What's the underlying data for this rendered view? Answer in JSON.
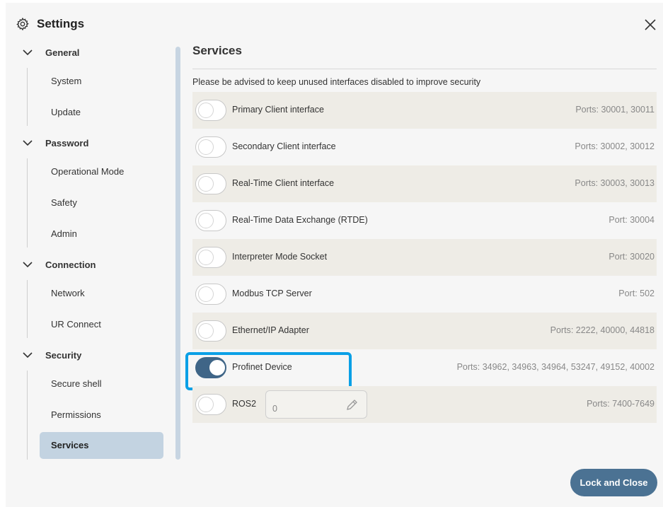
{
  "dialog": {
    "title": "Settings",
    "icon": "gear-icon",
    "close_icon": "close-icon"
  },
  "sidebar": {
    "sections": [
      {
        "label": "General",
        "items": [
          {
            "label": "System"
          },
          {
            "label": "Update"
          }
        ]
      },
      {
        "label": "Password",
        "items": [
          {
            "label": "Operational Mode"
          },
          {
            "label": "Safety"
          },
          {
            "label": "Admin"
          }
        ]
      },
      {
        "label": "Connection",
        "items": [
          {
            "label": "Network"
          },
          {
            "label": "UR Connect"
          }
        ]
      },
      {
        "label": "Security",
        "items": [
          {
            "label": "Secure shell"
          },
          {
            "label": "Permissions"
          },
          {
            "label": "Services",
            "active": true
          }
        ]
      }
    ]
  },
  "main": {
    "title": "Services",
    "advice": "Please be advised to keep unused interfaces disabled to improve security",
    "services": [
      {
        "name": "Primary Client interface",
        "ports": "Ports: 30001, 30011",
        "enabled": false
      },
      {
        "name": "Secondary Client interface",
        "ports": "Ports: 30002, 30012",
        "enabled": false
      },
      {
        "name": "Real-Time Client interface",
        "ports": "Ports: 30003, 30013",
        "enabled": false
      },
      {
        "name": "Real-Time Data Exchange (RTDE)",
        "ports": "Port: 30004",
        "enabled": false
      },
      {
        "name": "Interpreter Mode Socket",
        "ports": "Port: 30020",
        "enabled": false
      },
      {
        "name": "Modbus TCP Server",
        "ports": "Port: 502",
        "enabled": false
      },
      {
        "name": "Ethernet/IP Adapter",
        "ports": "Ports: 2222, 40000, 44818",
        "enabled": false
      },
      {
        "name": "Profinet Device",
        "ports": "Ports: 34962, 34963, 34964, 53247, 49152, 40002",
        "enabled": true,
        "highlighted": true
      },
      {
        "name": "ROS2",
        "ports": "Ports: 7400-7649",
        "enabled": false,
        "input_value": "0",
        "input_icon": "pencil-icon"
      }
    ]
  },
  "footer": {
    "lock_button": "Lock and Close"
  },
  "colors": {
    "accent": "#4b7293",
    "toggle_on": "#3f6587",
    "highlight": "#0aa0e6",
    "active_nav": "#c3d3e1",
    "row_shaded": "#eeece6"
  }
}
